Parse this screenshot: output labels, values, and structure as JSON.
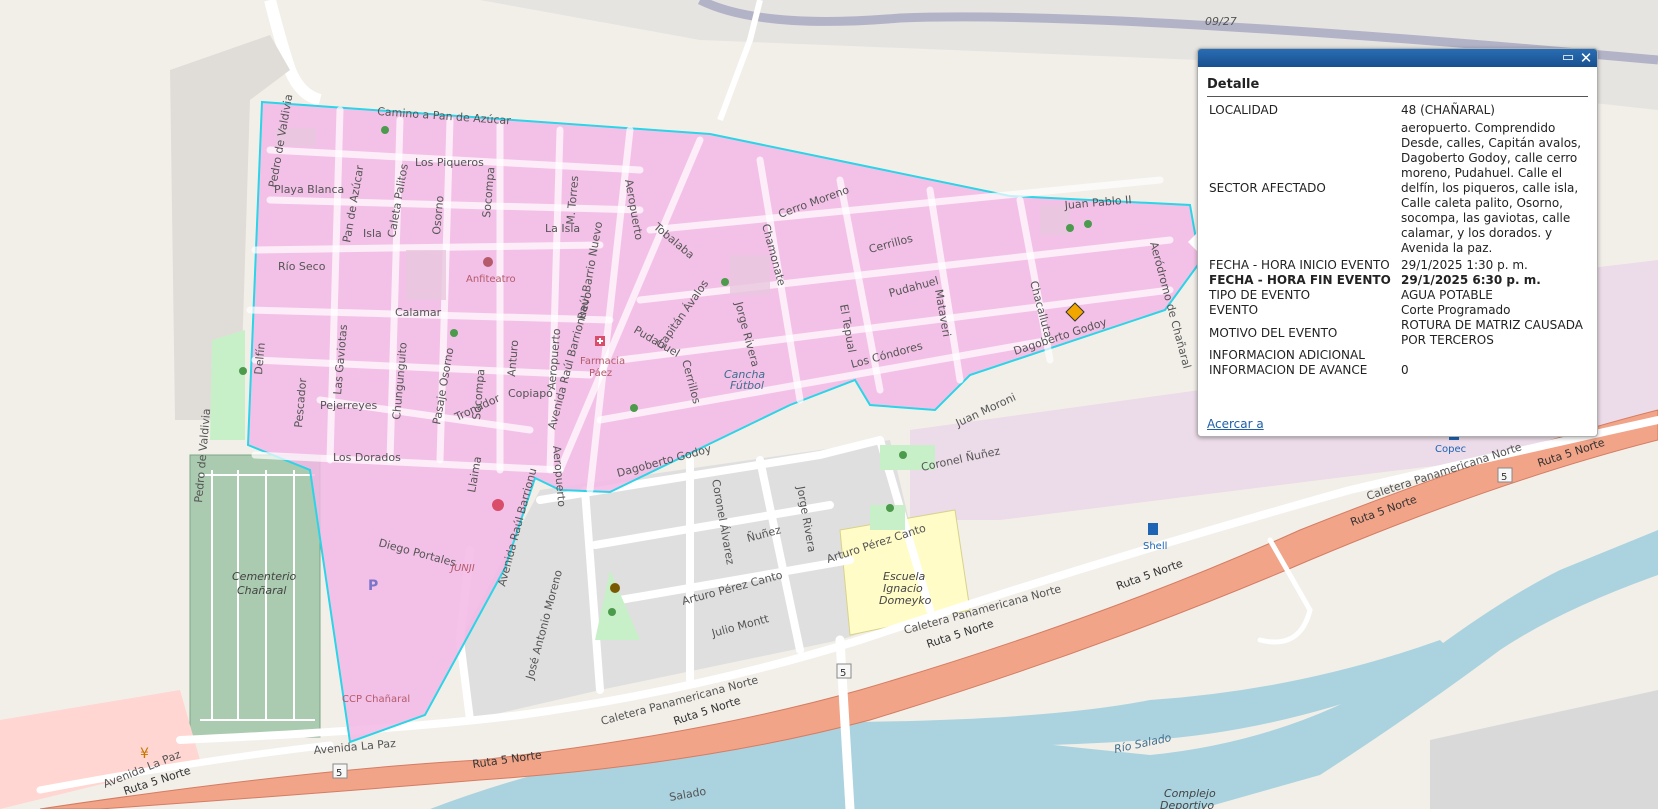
{
  "map": {
    "streets": [
      "Camino a Pan de Azúcar",
      "Los Piqueros",
      "Playa Blanca",
      "Pedro de Valdivia",
      "Pan de Azúcar",
      "Caleta Palitos",
      "Osorno",
      "Socompa",
      "M. Torres",
      "La Isla",
      "Isla",
      "Río Seco",
      "Anfiteatro",
      "Calamar",
      "Delfín",
      "Las Gaviotas",
      "Chungunguito",
      "Pasaje Osorno",
      "Socompa",
      "Anturo",
      "Aeropuerto",
      "Avenida Raúl Barrionuevo",
      "Raúl Barrio Nuevo",
      "Aeropuerto",
      "Tobalaba",
      "Capitán Ávalos",
      "Pudahuel",
      "Cerrillos",
      "Cerro Moreno",
      "Chamonate",
      "Jorge Rivera",
      "El Tepual",
      "Cerrillos",
      "Pudahuel",
      "Los Cóndores",
      "Mataveri",
      "Chacalluta",
      "Dagoberto Godoy",
      "Juan Pablo II",
      "Aeródromo de Chañaral",
      "Pescador",
      "Pejerreyes",
      "Tronador",
      "Copiapó",
      "Los Dorados",
      "Llaima",
      "Aeropuerto",
      "Dagoberto Godoy",
      "Juan Moroni",
      "Coronel Ñuñez",
      "Coronel Álvarez",
      "Ñuñez",
      "Jorge Rivera",
      "Arturo Pérez Canto",
      "Arturo Pérez Canto",
      "Julio Montt",
      "Avenida Raúl Barrionu",
      "José Antonio Moreno",
      "Diego Portales",
      "Pedro de Valdivia",
      "Caletera Panamericana Norte",
      "Caletera Panamericana Norte",
      "Caletera Panamericana Norte",
      "Ruta 5 Norte",
      "Ruta 5 Norte",
      "Ruta 5 Norte",
      "Ruta 5 Norte",
      "Ruta 5 Norte",
      "Ruta 5 Norte",
      "Avenida La Paz",
      "Avenida La Paz",
      "Ruta 5 Norte",
      "Salado"
    ],
    "pois": {
      "farmacia": "Farmacia Páez",
      "cancha": "Cancha Fútbol",
      "cementerio": "Cementerio Chañaral",
      "escuela": "Escuela Ignacio Domeyko",
      "ccp": "CCP Chañaral",
      "junji": "JUNJI",
      "shell": "Shell",
      "copec": "Copec",
      "complejo": "Complejo Deportivo",
      "rio": "Río Salado",
      "highway_marker": "5",
      "date_label": "09/27"
    },
    "colors": {
      "polygon_fill": "#f3b9e6",
      "polygon_stroke": "#2bd4e6",
      "highway": "#f1a488",
      "water": "#aad3df",
      "cemetery": "#aacbaf",
      "school": "#fffcc8"
    }
  },
  "popup": {
    "title": "Detalle",
    "maximize_icon": "maximize-icon",
    "close_icon": "close-icon",
    "rows": [
      {
        "key": "LOCALIDAD",
        "value": "48 (CHAÑARAL)"
      },
      {
        "key": "SECTOR AFECTADO",
        "value": "aeropuerto. Comprendido Desde, calles, Capitán avalos, Dagoberto Godoy, calle cerro moreno, Pudahuel. Calle el delfín, los piqueros, calle isla, Calle caleta palito, Osorno, socompa, las gaviotas, calle calamar, y los dorados. y Avenida la paz."
      },
      {
        "key": "FECHA - HORA INICIO EVENTO",
        "value": "29/1/2025 1:30 p. m."
      },
      {
        "key": "FECHA - HORA FIN EVENTO",
        "value": "29/1/2025 6:30 p. m."
      },
      {
        "key": "TIPO DE EVENTO",
        "value": "AGUA POTABLE"
      },
      {
        "key": "EVENTO",
        "value": "Corte Programado"
      },
      {
        "key": "MOTIVO DEL EVENTO",
        "value": "ROTURA DE MATRIZ CAUSADA POR TERCEROS"
      },
      {
        "key": "INFORMACION ADICIONAL",
        "value": ""
      },
      {
        "key": "INFORMACION DE AVANCE",
        "value": "0"
      }
    ],
    "zoom_link": "Acercar a"
  }
}
